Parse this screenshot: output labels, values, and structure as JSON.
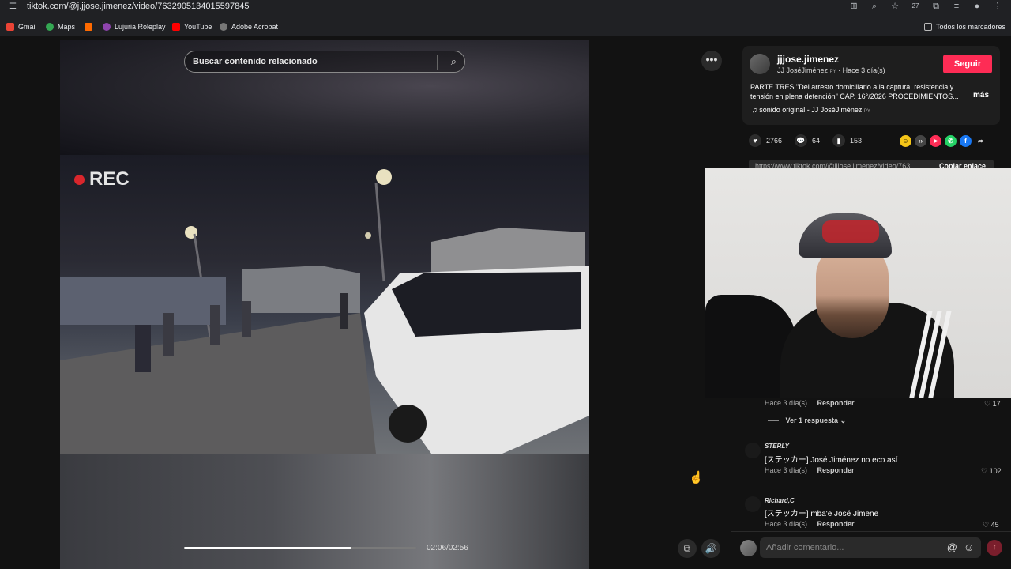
{
  "browser": {
    "url": "tiktok.com/@j.jjose.jimenez/video/7632905134015597845",
    "tab_count": "27",
    "bookmarks": [
      {
        "label": "Gmail",
        "color": "#ea4335"
      },
      {
        "label": "Maps",
        "color": "#34a853"
      },
      {
        "label": "",
        "color": "#ff6a00"
      },
      {
        "label": "Lujuria Roleplay",
        "color": "#8e44ad"
      },
      {
        "label": "YouTube",
        "color": "#ff0000"
      },
      {
        "label": "Adobe Acrobat",
        "color": "#555555"
      }
    ],
    "all_bookmarks": "Todos los marcadores"
  },
  "video": {
    "search_placeholder": "Buscar contenido relacionado",
    "rec_label": "REC",
    "progress": 0.72,
    "time": "02:06/02:56"
  },
  "post": {
    "username": "jjjose.jimenez",
    "display": "JJ JoséJiménez",
    "flag": "PY",
    "age": "Hace 3 día(s)",
    "follow": "Seguir",
    "description": "PARTE TRES \"Del arresto domiciliario a la captura: resistencia y tensión en plena detención\" CAP. 16°/2026 PROCEDIMIENTOS...",
    "more": "más",
    "sound": "sonido original - JJ JoséJiménez",
    "sound_flag": "PY",
    "likes": "2766",
    "comments": "64",
    "saves": "153",
    "link": "https://www.tiktok.com/@jjjose.jimenez/video/763...",
    "copy_link": "Copiar enlace",
    "share_colors": [
      "#f5c518",
      "#444444",
      "#fe2c55",
      "#25d366",
      "#1877f2",
      "#2c2c2c"
    ]
  },
  "comments": [
    {
      "meta": "Hace 3 día(s)",
      "reply": "Responder",
      "likes": "17",
      "view_replies": "Ver 1 respuesta"
    },
    {
      "name": "STERLY",
      "text": "[ステッカー] José Jiménez no eco así",
      "meta": "Hace 3 día(s)",
      "reply": "Responder",
      "likes": "102"
    },
    {
      "name": "Richard,C",
      "text": "[ステッカー] mba'e José Jimene",
      "meta": "Hace 3 día(s)",
      "reply": "Responder",
      "likes": "45"
    }
  ],
  "composer": {
    "placeholder": "Añadir comentario..."
  }
}
